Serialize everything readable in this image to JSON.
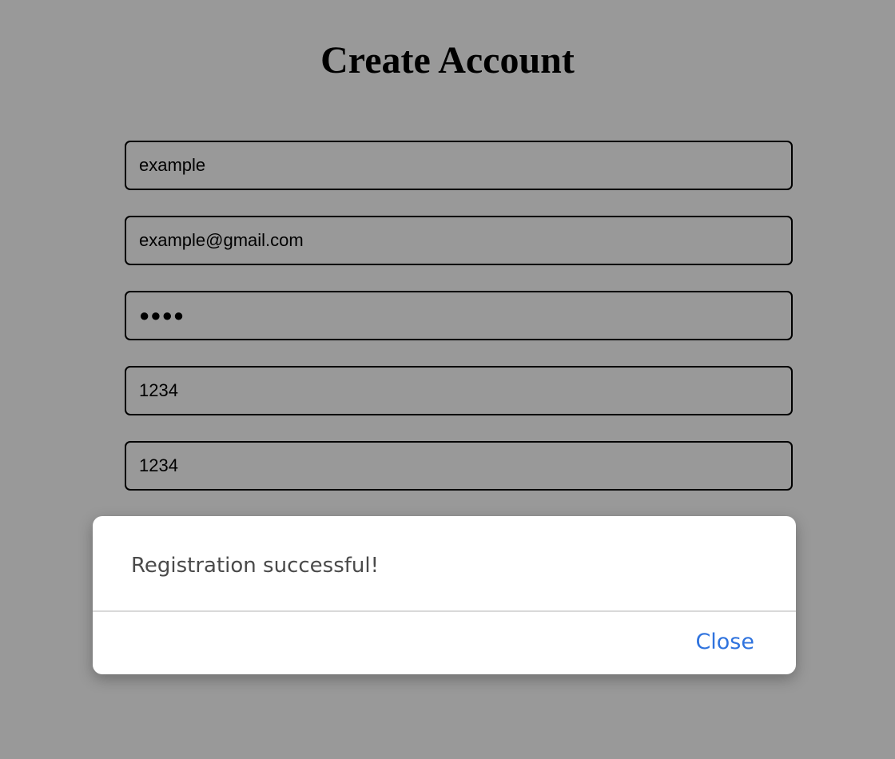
{
  "page": {
    "title": "Create Account",
    "background_color": "#999999"
  },
  "form": {
    "fields": [
      {
        "name": "username",
        "value": "example"
      },
      {
        "name": "email",
        "value": "example@gmail.com"
      },
      {
        "name": "password",
        "value": "●●●●"
      },
      {
        "name": "field-4",
        "value": "1234"
      },
      {
        "name": "field-5",
        "value": "1234"
      }
    ]
  },
  "dialog": {
    "message": "Registration successful!",
    "close_label": "Close",
    "accent_color": "#2f73de"
  }
}
